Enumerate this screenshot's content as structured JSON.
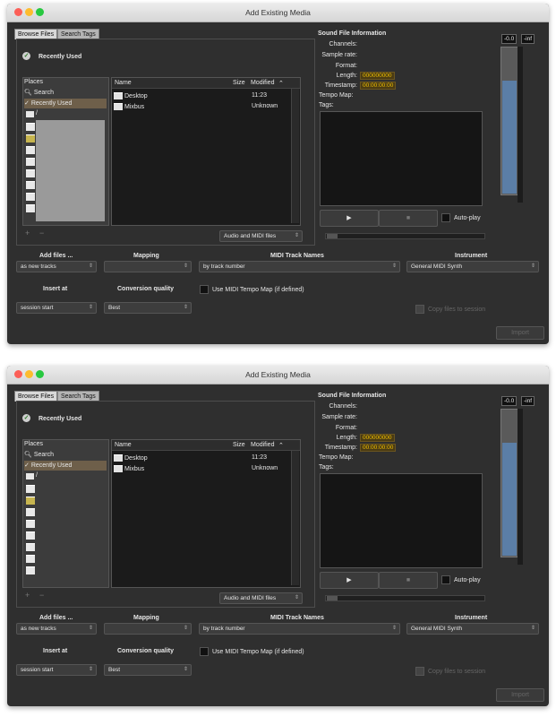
{
  "window": {
    "title": "Add Existing Media"
  },
  "tabs": [
    {
      "label": "Browse Files"
    },
    {
      "label": "Search Tags"
    }
  ],
  "recently_used_heading": "Recently Used",
  "places": {
    "header": "Places",
    "items": [
      {
        "label": "Search"
      },
      {
        "label": "Recently Used"
      }
    ],
    "root_label": "/"
  },
  "file_list": {
    "columns": {
      "name": "Name",
      "size": "Size",
      "modified": "Modified"
    },
    "rows": [
      {
        "name": "Desktop",
        "modified": "11:23"
      },
      {
        "name": "Mixbus",
        "modified": "Unknown"
      }
    ],
    "filter": "Audio and MIDI files"
  },
  "sound_info": {
    "title": "Sound File Information",
    "channels_label": "Channels:",
    "sample_rate_label": "Sample rate:",
    "format_label": "Format:",
    "length_label": "Length:",
    "length_value": "000000000",
    "timestamp_label": "Timestamp:",
    "timestamp_value": "00:00:00:00",
    "tempo_map_label": "Tempo Map:",
    "tags_label": "Tags:"
  },
  "meter": {
    "left_peak": "-0.0",
    "right_peak": "-inf",
    "level": 0.78
  },
  "playback": {
    "autoplay_label": "Auto-play"
  },
  "options": {
    "add_files_label": "Add files ...",
    "add_files_value": "as new tracks",
    "mapping_label": "Mapping",
    "mapping_value": "",
    "midi_track_names_label": "MIDI Track Names",
    "midi_track_names_value": "by track number",
    "instrument_label": "Instrument",
    "instrument_value": "General MIDI Synth",
    "insert_at_label": "Insert at",
    "insert_at_value": "session start",
    "conversion_quality_label": "Conversion quality",
    "conversion_quality_value": "Best",
    "use_midi_tempo_label": "Use MIDI Tempo Map (if defined)",
    "copy_files_label": "Copy files to session",
    "import_label": "Import"
  },
  "colors": {
    "accent_yellow": "#f0c000",
    "meter_blue": "#5b7ea6",
    "selection": "#6e5f4a"
  }
}
